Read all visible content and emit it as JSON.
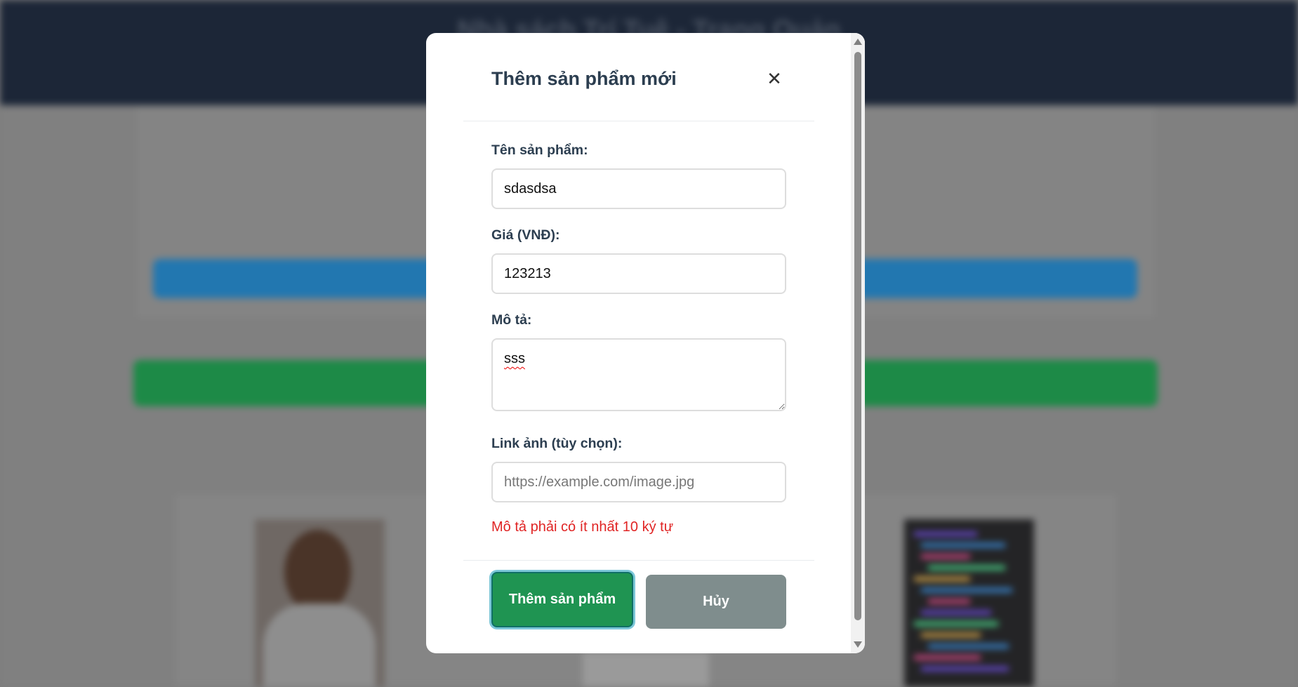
{
  "background": {
    "header_title": "Nhà sách Trí Tuệ - Trang Quản"
  },
  "modal": {
    "title": "Thêm sản phẩm mới",
    "close_icon": "close-icon",
    "close_glyph": "✕",
    "fields": {
      "name": {
        "label": "Tên sản phẩm:",
        "value": "sdasdsa",
        "placeholder": ""
      },
      "price": {
        "label": "Giá (VNĐ):",
        "value": "123213",
        "placeholder": ""
      },
      "description": {
        "label": "Mô tả:",
        "value": "sss",
        "placeholder": ""
      },
      "image_link": {
        "label": "Link ảnh (tùy chọn):",
        "value": "",
        "placeholder": "https://example.com/image.jpg"
      }
    },
    "error_message": "Mô tả phải có ít nhất 10 ký tự",
    "submit_label": "Thêm sản phẩm",
    "cancel_label": "Hủy"
  },
  "colors": {
    "submit": "#1f9452",
    "cancel": "#7f8d8d",
    "error": "#e02424",
    "header": "#1c2637"
  }
}
